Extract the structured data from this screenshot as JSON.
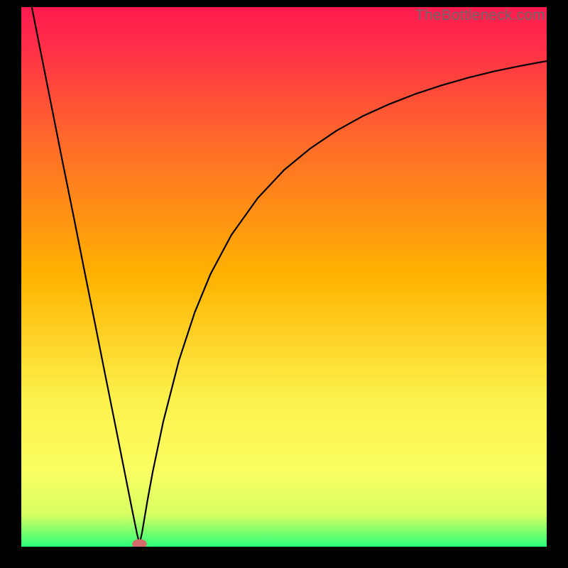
{
  "watermark": "TheBottleneck.com",
  "chart_data": {
    "type": "line",
    "title": "",
    "xlabel": "",
    "ylabel": "",
    "xlim": [
      0,
      100
    ],
    "ylim": [
      0,
      100
    ],
    "grid": false,
    "legend": false,
    "background_gradient": {
      "top": "#ff1a4d",
      "quarter": "#ff5a2a",
      "mid": "#ffb300",
      "three_quarter": "#fff94a",
      "bottom": "#2bff78"
    },
    "marker": {
      "x": 22.5,
      "y": 0.5,
      "shape": "ellipse",
      "color": "#d46a6a",
      "rx": 1.4,
      "ry": 0.9
    },
    "series": [
      {
        "name": "curve",
        "color": "#000000",
        "x": [
          2,
          4,
          6,
          8,
          10,
          12,
          14,
          16,
          18,
          20,
          21,
          22,
          22.5,
          23,
          24,
          25,
          27,
          30,
          33,
          36,
          40,
          45,
          50,
          55,
          60,
          65,
          70,
          75,
          80,
          85,
          90,
          95,
          100
        ],
        "y": [
          100,
          90.2,
          80.4,
          70.6,
          61.0,
          51.2,
          41.5,
          31.7,
          22.0,
          12.2,
          7.3,
          2.5,
          0.5,
          2.7,
          8.5,
          13.8,
          23.1,
          34.5,
          43.4,
          50.5,
          57.8,
          64.6,
          69.8,
          73.8,
          77.1,
          79.8,
          82.0,
          83.9,
          85.5,
          86.9,
          88.1,
          89.1,
          90.0
        ]
      }
    ]
  }
}
